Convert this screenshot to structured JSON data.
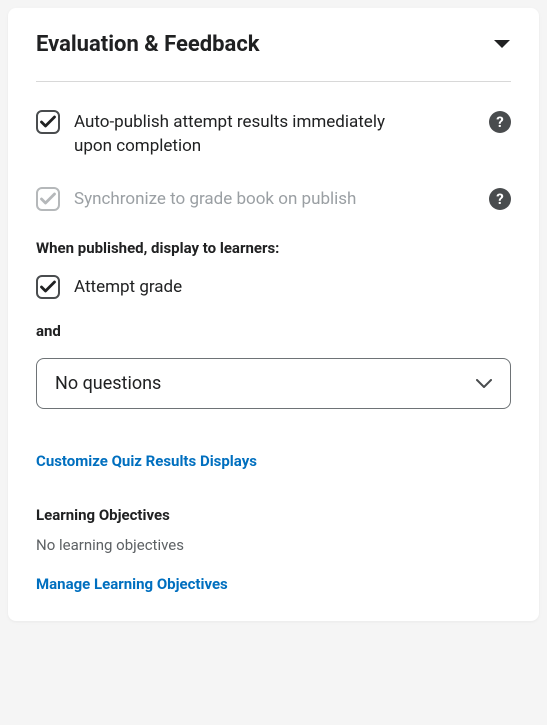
{
  "header": {
    "title": "Evaluation & Feedback"
  },
  "options": {
    "auto_publish": {
      "label": "Auto-publish attempt results immediately upon completion",
      "checked": true,
      "disabled": false
    },
    "sync_gradebook": {
      "label": "Synchronize to grade book on publish",
      "checked": true,
      "disabled": true
    }
  },
  "display_section": {
    "heading": "When published, display to learners:",
    "attempt_grade": {
      "label": "Attempt grade",
      "checked": true
    },
    "conjunction": "and",
    "dropdown_value": "No questions"
  },
  "links": {
    "customize_displays": "Customize Quiz Results Displays",
    "manage_objectives": "Manage Learning Objectives"
  },
  "learning_objectives": {
    "heading": "Learning Objectives",
    "empty_text": "No learning objectives"
  },
  "icons": {
    "help_glyph": "?"
  }
}
